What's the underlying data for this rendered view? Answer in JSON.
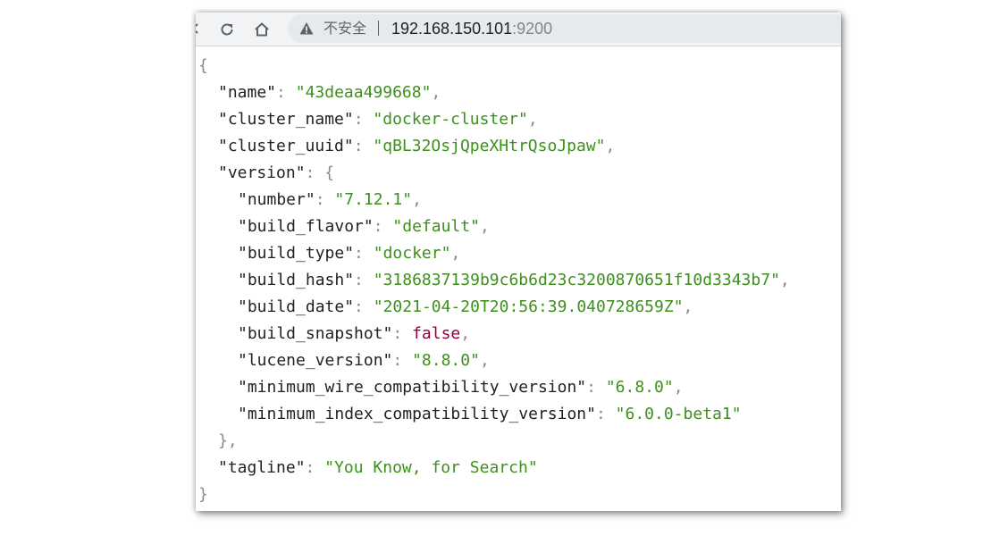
{
  "browser": {
    "security_label": "不安全",
    "url_host": "192.168.150.101",
    "url_port": ":9200"
  },
  "json": {
    "name": "43deaa499668",
    "cluster_name": "docker-cluster",
    "cluster_uuid": "qBL32OsjQpeXHtrQsoJpaw",
    "version": {
      "number": "7.12.1",
      "build_flavor": "default",
      "build_type": "docker",
      "build_hash": "3186837139b9c6b6d23c3200870651f10d3343b7",
      "build_date": "2021-04-20T20:56:39.040728659Z",
      "build_snapshot": "false",
      "lucene_version": "8.8.0",
      "minimum_wire_compatibility_version": "6.8.0",
      "minimum_index_compatibility_version": "6.0.0-beta1"
    },
    "tagline": "You Know, for Search"
  },
  "icons": {
    "reload": "reload-icon",
    "home": "home-icon",
    "warning": "warning-icon"
  },
  "colors": {
    "key": "#222222",
    "string": "#3e8f1e",
    "boolean": "#92003c",
    "punctuation": "#8a8a8a"
  }
}
